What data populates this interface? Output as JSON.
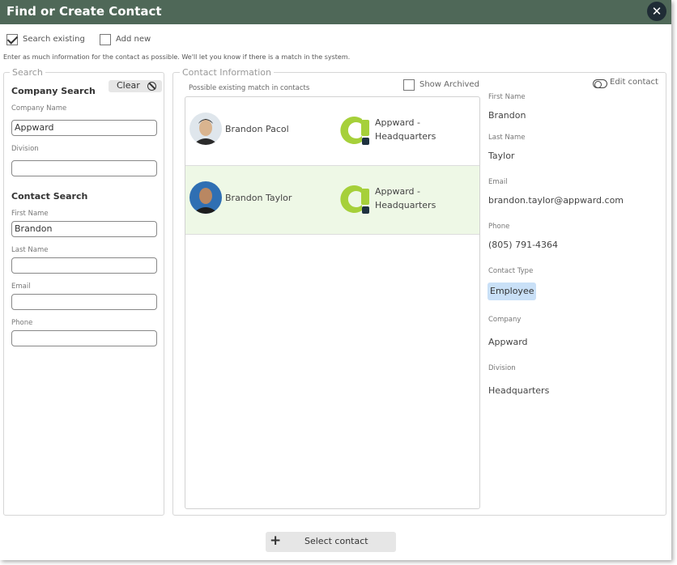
{
  "dialog": {
    "title": "Find or Create Contact",
    "close_icon": "close-icon",
    "header_color": "#4f6858"
  },
  "mode": {
    "search_existing": {
      "label": "Search existing",
      "checked": true
    },
    "add_new": {
      "label": "Add new",
      "checked": false
    }
  },
  "hint": "Enter as much information for the contact as possible. We'll let you know if there is a match in the system.",
  "search": {
    "legend": "Search",
    "clear_label": "Clear",
    "clear_icon": "ban-icon",
    "company_section": "Company Search",
    "company_name_label": "Company Name",
    "company_name_value": "Appward",
    "division_label": "Division",
    "division_value": "",
    "contact_section": "Contact Search",
    "first_name_label": "First Name",
    "first_name_value": "Brandon",
    "last_name_label": "Last Name",
    "last_name_value": "",
    "email_label": "Email",
    "email_value": "",
    "phone_label": "Phone",
    "phone_value": ""
  },
  "contact_info": {
    "legend": "Contact Information",
    "list_caption": "Possible existing match in contacts",
    "show_archived_label": "Show Archived",
    "show_archived_checked": false,
    "edit_contact_label": "Edit contact",
    "edit_icon": "toggle-icon",
    "matches": [
      {
        "name": "Brandon Pacol",
        "company_line1": "Appward -",
        "company_line2": "Headquarters",
        "selected": false
      },
      {
        "name": "Brandon Taylor",
        "company_line1": "Appward -",
        "company_line2": "Headquarters",
        "selected": true
      }
    ],
    "details": {
      "first_name_label": "First Name",
      "first_name": "Brandon",
      "last_name_label": "Last Name",
      "last_name": "Taylor",
      "email_label": "Email",
      "email": "brandon.taylor@appward.com",
      "phone_label": "Phone",
      "phone": "(805) 791-4364",
      "contact_type_label": "Contact Type",
      "contact_type": "Employee",
      "company_label": "Company",
      "company": "Appward",
      "division_label": "Division",
      "division": "Headquarters"
    },
    "selected_row_color": "#eef8e6",
    "badge_color": "#c9e0f7"
  },
  "footer": {
    "select_label": "Select contact",
    "select_icon": "plus-icon"
  },
  "colors": {
    "logo_green": "#a6d03a",
    "logo_dark": "#1f3240"
  }
}
